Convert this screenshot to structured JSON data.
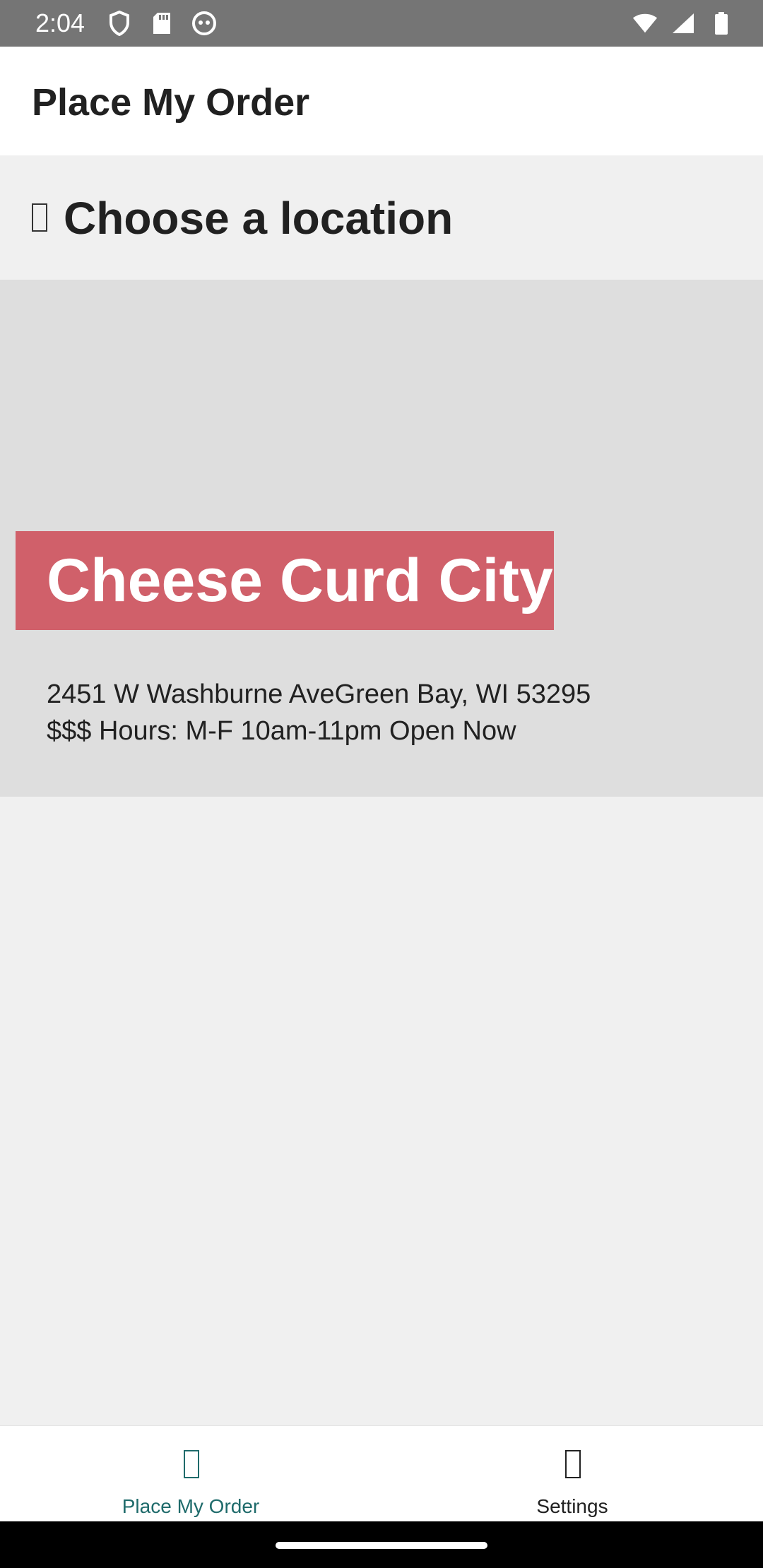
{
  "status_bar": {
    "time": "2:04",
    "icons_left": [
      "shield-icon",
      "sd-card-icon",
      "android-icon"
    ],
    "icons_right": [
      "wifi-icon",
      "cellular-signal-icon",
      "battery-icon"
    ],
    "background": "#757575"
  },
  "app_bar": {
    "title": "Place My Order"
  },
  "header": {
    "icon": "glyph-placeholder-icon",
    "title": "Choose a location"
  },
  "location": {
    "name": "Cheese Curd City",
    "address": "2451 W Washburne AveGreen Bay, WI 53295",
    "details": "$$$ Hours: M-F 10am-11pm Open Now",
    "banner_color": "#d0606a"
  },
  "bottom_nav": {
    "items": [
      {
        "label": "Place My Order",
        "icon": "glyph-placeholder-icon",
        "active": true
      },
      {
        "label": "Settings",
        "icon": "glyph-placeholder-icon",
        "active": false
      }
    ],
    "active_color": "#1f6b6b"
  }
}
